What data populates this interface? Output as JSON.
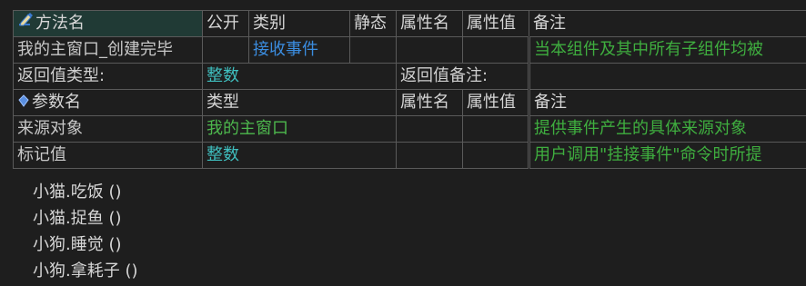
{
  "method_table": {
    "header": {
      "name": "方法名",
      "public": "公开",
      "category": "类别",
      "static": "静态",
      "prop_name": "属性名",
      "prop_value": "属性值",
      "remark": "备注"
    },
    "method": {
      "name": "我的主窗口_创建完毕",
      "public": "",
      "category": "接收事件",
      "static": "",
      "prop_name": "",
      "prop_value": "",
      "remark": "当本组件及其中所有子组件均被"
    },
    "return_row": {
      "type_label": "返回值类型:",
      "type_value": "整数",
      "remark_label": "返回值备注:",
      "remark_value": ""
    },
    "param_header": {
      "name": "参数名",
      "type": "类型",
      "prop_name": "属性名",
      "prop_value": "属性值",
      "remark": "备注"
    },
    "params": [
      {
        "name": "来源对象",
        "type": "我的主窗口",
        "prop_name": "",
        "prop_value": "",
        "remark": "提供事件产生的具体来源对象"
      },
      {
        "name": "标记值",
        "type": "整数",
        "prop_name": "",
        "prop_value": "",
        "remark": "用户调用\"挂接事件\"命令时所提"
      }
    ]
  },
  "code_lines": [
    "小猫.吃饭 ()",
    "小猫.捉鱼 ()",
    "小狗.睡觉 ()",
    "小狗.拿耗子 ()"
  ],
  "icons": {
    "method_icon": "pencil-icon",
    "param_icon": "diamond-icon"
  }
}
